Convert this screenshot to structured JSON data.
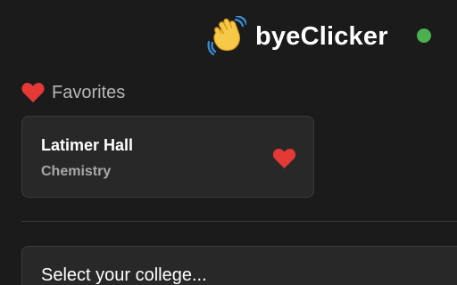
{
  "header": {
    "brand_icon": "waving-hand-icon",
    "title": "byeClicker",
    "status_color": "#4caf50"
  },
  "favorites": {
    "icon": "heart-icon",
    "label": "Favorites",
    "items": [
      {
        "title": "Latimer Hall",
        "subtitle": "Chemistry",
        "icon": "heart-icon",
        "favorited": true
      }
    ]
  },
  "college_select": {
    "placeholder": "Select your college..."
  },
  "colors": {
    "background": "#1b1b1b",
    "card": "#282828",
    "accent_heart": "#e53935",
    "status_online": "#4caf50"
  }
}
